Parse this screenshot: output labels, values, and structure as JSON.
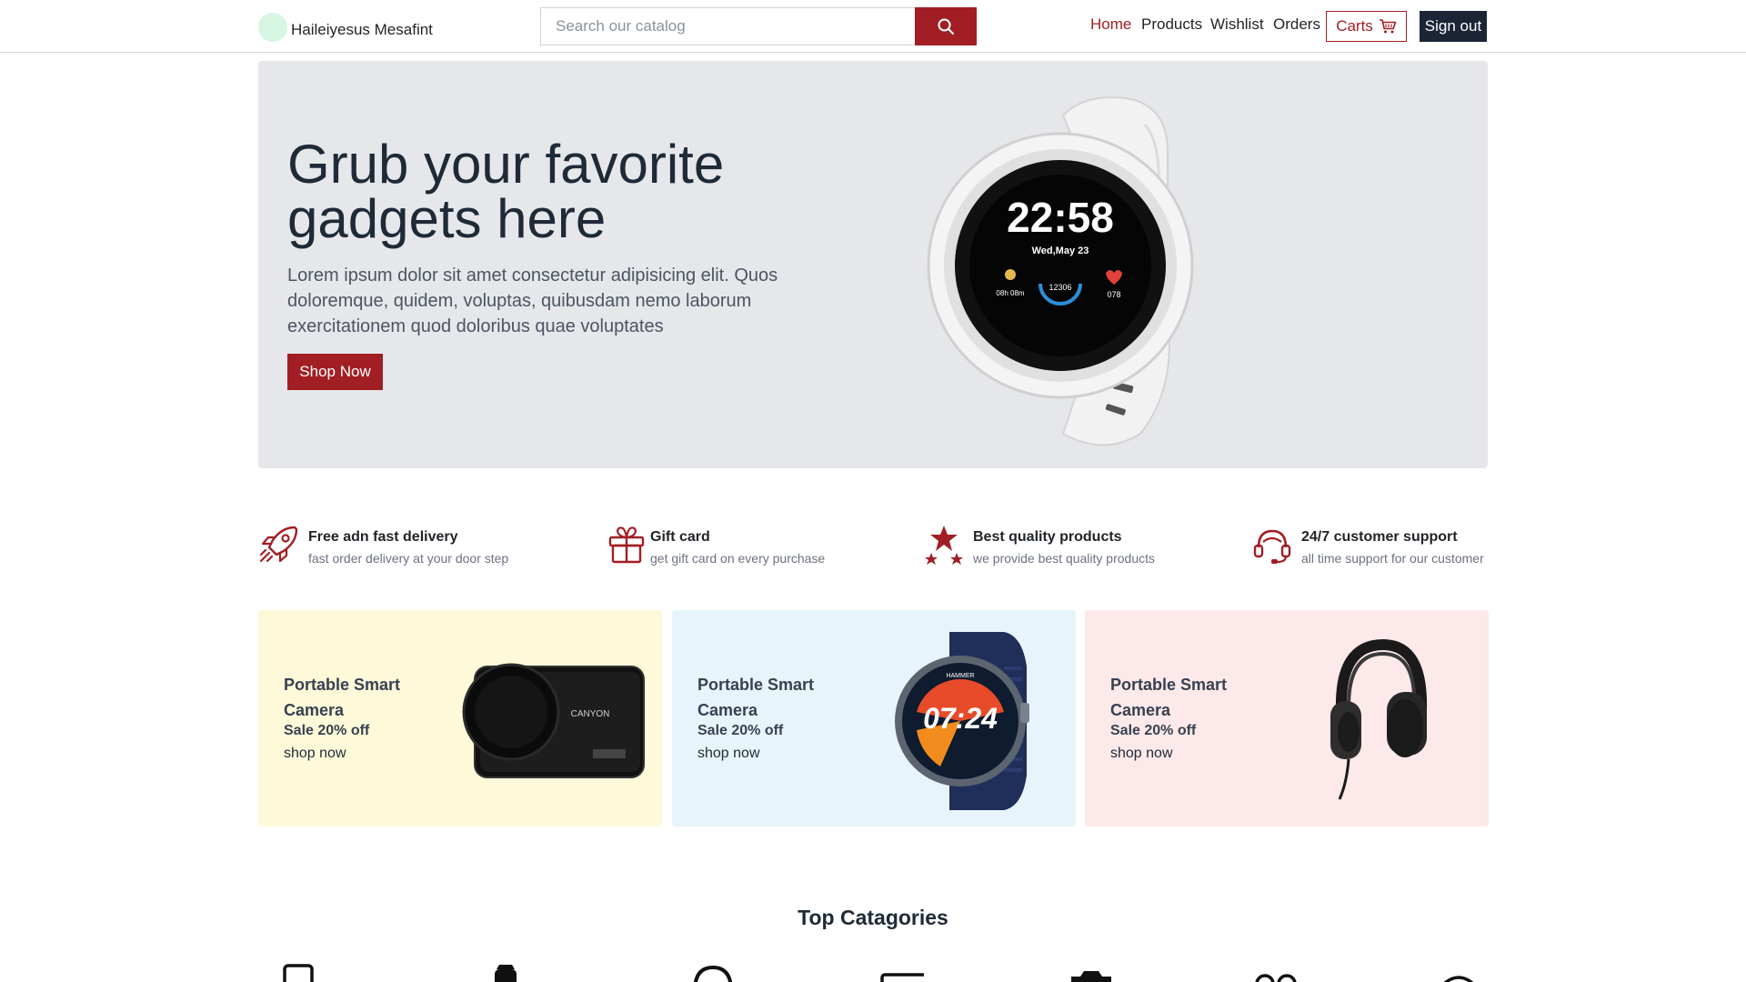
{
  "brand": {
    "name": "Haileiyesus Mesafint"
  },
  "search": {
    "placeholder": "Search our catalog"
  },
  "nav": {
    "home": "Home",
    "products": "Products",
    "wishlist": "Wishlist",
    "orders": "Orders",
    "carts": "Carts",
    "sign_out": "Sign out"
  },
  "hero": {
    "title": "Grub your favorite gadgets here",
    "text": "Lorem ipsum dolor sit amet consectetur adipisicing elit. Quos doloremque, quidem, voluptas, quibusdam nemo laborum exercitationem quod doloribus quae voluptates",
    "button": "Shop Now",
    "watch_time": "22:58",
    "watch_date": "Wed,May 23",
    "watch_sleep": "08h 08m",
    "watch_steps": "12306",
    "watch_heart": "078"
  },
  "features": [
    {
      "title": "Free adn fast delivery",
      "subtitle": "fast order delivery at your door step",
      "icon": "rocket-icon"
    },
    {
      "title": "Gift card",
      "subtitle": "get gift card on every purchase",
      "icon": "gift-icon"
    },
    {
      "title": "Best quality products",
      "subtitle": "we provide best quality products",
      "icon": "stars-icon"
    },
    {
      "title": "24/7 customer support",
      "subtitle": "all time support for our customer",
      "icon": "headset-icon"
    }
  ],
  "promos": [
    {
      "title": "Portable Smart Camera",
      "sale": "Sale 20% off",
      "link": "shop now",
      "bg": "#fefad9",
      "image": "dashcam-image",
      "brand_text": "CANYON"
    },
    {
      "title": "Portable Smart Camera",
      "sale": "Sale 20% off",
      "link": "shop now",
      "bg": "#e8f4fc",
      "image": "smartwatch-image",
      "brand_text": "HAMMER",
      "time_text": "07:24"
    },
    {
      "title": "Portable Smart Camera",
      "sale": "Sale 20% off",
      "link": "shop now",
      "bg": "#fde9e9",
      "image": "headphones-image"
    }
  ],
  "categories": {
    "heading": "Top Catagories",
    "icons": [
      "phone-icon",
      "smartwatch-icon",
      "headphones-icon",
      "laptop-icon",
      "camera-icon",
      "gamepad-icon",
      "speaker-icon"
    ]
  },
  "colors": {
    "accent": "#a11f24",
    "dark": "#1c2536",
    "hero_bg": "#e6e7ea"
  }
}
